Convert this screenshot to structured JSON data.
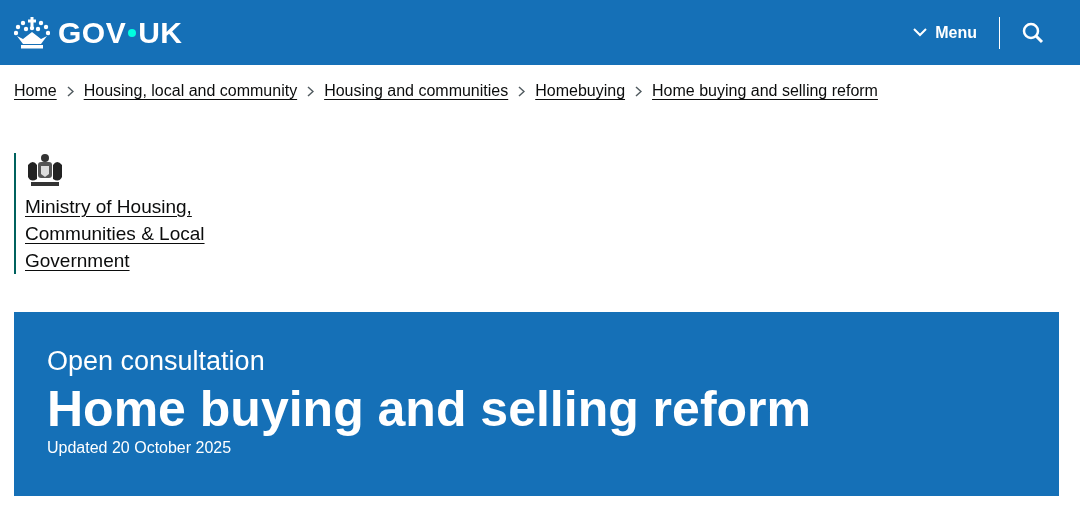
{
  "header": {
    "logo": [
      "GOV",
      "UK"
    ],
    "menu_button": "Menu"
  },
  "breadcrumbs": [
    "Home",
    "Housing, local and community",
    "Housing and communities",
    "Homebuying",
    "Home buying and selling reform"
  ],
  "organisation": {
    "name": "Ministry of Housing, Communities & Local Government",
    "color": "#00625e"
  },
  "banner": {
    "caption": "Open consultation",
    "title": "Home buying and selling reform",
    "updated": "Updated 20 October 2025"
  }
}
